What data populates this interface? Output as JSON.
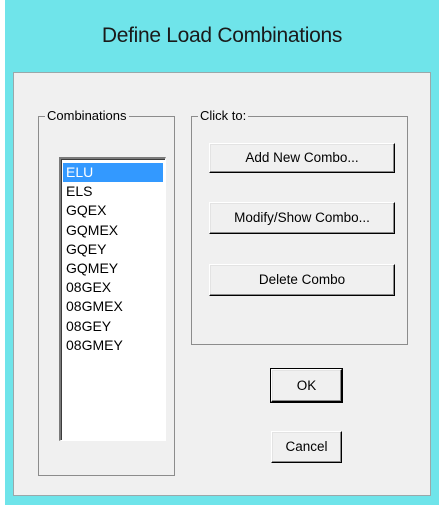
{
  "window": {
    "title": "Define Load Combinations"
  },
  "combinations": {
    "label": "Combinations",
    "items": [
      "ELU",
      "ELS",
      "GQEX",
      "GQMEX",
      "GQEY",
      "GQMEY",
      "08GEX",
      "08GMEX",
      "08GEY",
      "08GMEY"
    ],
    "selected": "ELU"
  },
  "click_to": {
    "label": "Click to:",
    "add_label": "Add New Combo...",
    "modify_label": "Modify/Show Combo...",
    "delete_label": "Delete Combo"
  },
  "ok_label": "OK",
  "cancel_label": "Cancel"
}
